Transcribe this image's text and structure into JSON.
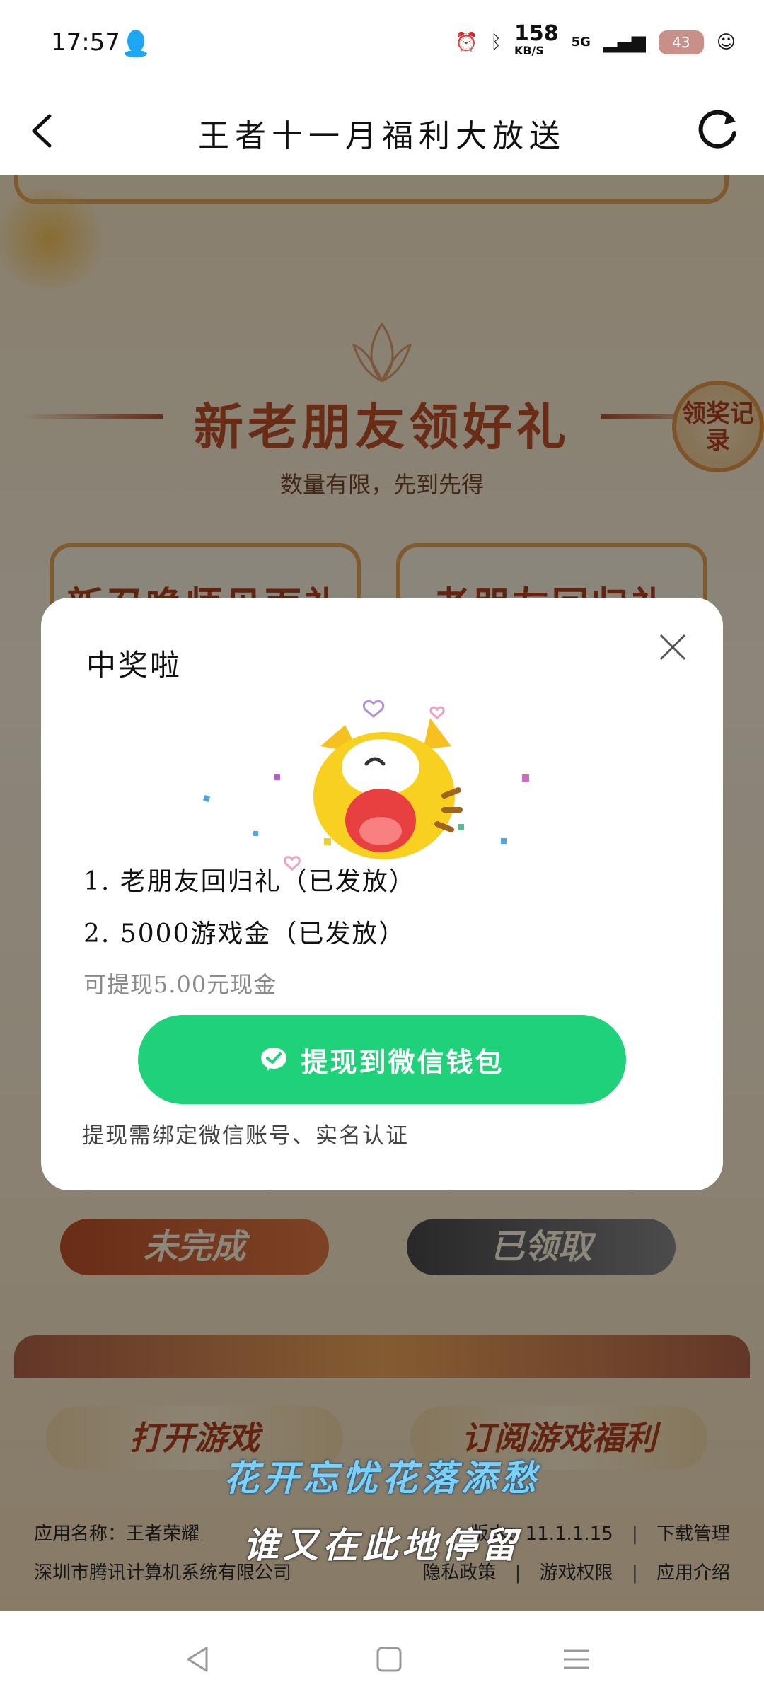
{
  "status_bar": {
    "time": "17:57",
    "net_speed": "158",
    "net_speed_unit": "KB/S",
    "network": "5G",
    "battery": "43"
  },
  "header": {
    "title": "王者十一月福利大放送"
  },
  "event": {
    "title": "新老朋友领好礼",
    "subtitle": "数量有限，先到先得",
    "record_badge": "领奖记录",
    "card_left_title": "新召唤师见面礼",
    "card_right_title": "老朋友回归礼",
    "status_left": "未完成",
    "status_right": "已领取",
    "btn_open_game": "打开游戏",
    "btn_subscribe": "订阅游戏福利"
  },
  "footer": {
    "app_name": "应用名称：王者荣耀",
    "version": "版本：11.1.1.15",
    "download": "下载管理",
    "company": "深圳市腾讯计算机系统有限公司",
    "privacy": "隐私政策",
    "permissions": "游戏权限",
    "intro": "应用介绍"
  },
  "lyrics": {
    "line1": "花开忘忧花落添愁",
    "line2": "谁又在此地停留"
  },
  "modal": {
    "title": "中奖啦",
    "reward1": "1. 老朋友回归礼（已发放）",
    "reward2": "2. 5000游戏金（已发放）",
    "withdraw_amount": "可提现5.00元现金",
    "withdraw_button": "提现到微信钱包",
    "note": "提现需绑定微信账号、实名认证"
  },
  "colors": {
    "accent_green": "#1fd27a",
    "event_red": "#c0522a"
  }
}
